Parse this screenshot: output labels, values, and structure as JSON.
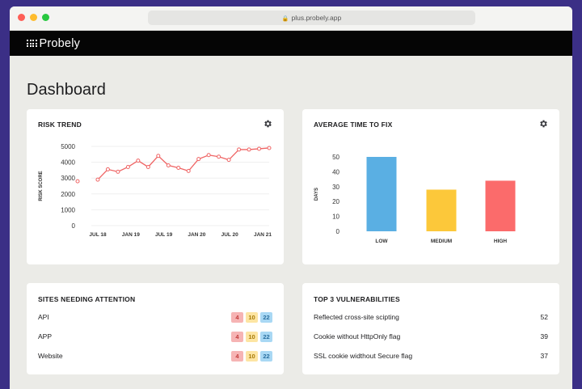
{
  "browser": {
    "url": "plus.probely.app"
  },
  "app": {
    "brand": "Probely"
  },
  "page": {
    "title": "Dashboard"
  },
  "risk_trend": {
    "title": "RISK TREND",
    "chart_data": {
      "type": "line",
      "title": "RISK TREND",
      "ylabel": "RISK SCORE",
      "xlabel": "",
      "ylim": [
        0,
        5000
      ],
      "yticks": [
        0,
        1000,
        2000,
        3000,
        4000,
        5000
      ],
      "xtick_labels": [
        "JUL 18",
        "JAN 19",
        "JUL 19",
        "JAN 20",
        "JUL 20",
        "JAN 21"
      ],
      "grid": true,
      "color": "#ef6464",
      "series": [
        {
          "values": [
            2800,
            null,
            2900,
            3550,
            3400,
            3700,
            4100,
            3700,
            4400,
            3800,
            3650,
            3450,
            4200,
            4450,
            4350,
            4150,
            4800,
            4800,
            4850,
            4900
          ]
        }
      ]
    }
  },
  "avg_time_fix": {
    "title": "AVERAGE TIME TO FIX",
    "chart_data": {
      "type": "bar",
      "title": "AVERAGE TIME TO FIX",
      "ylabel": "DAYS",
      "xlabel": "",
      "categories": [
        "LOW",
        "MEDIUM",
        "HIGH"
      ],
      "values": [
        50,
        28,
        34
      ],
      "ylim": [
        0,
        50
      ],
      "yticks": [
        0,
        10,
        20,
        30,
        40,
        50
      ],
      "colors": [
        "#5aafe3",
        "#fcc83a",
        "#fb6b6b"
      ]
    }
  },
  "sites": {
    "title": "SITES NEEDING ATTENTION",
    "rows": [
      {
        "name": "API",
        "high": "4",
        "medium": "10",
        "low": "22"
      },
      {
        "name": "APP",
        "high": "4",
        "medium": "10",
        "low": "22"
      },
      {
        "name": "Website",
        "high": "4",
        "medium": "10",
        "low": "22"
      }
    ]
  },
  "top_vulns": {
    "title": "TOP 3 VULNERABILITIES",
    "rows": [
      {
        "name": "Reflected cross-site scipting",
        "count": "52"
      },
      {
        "name": "Cookie without HttpOnly flag",
        "count": "39"
      },
      {
        "name": "SSL cookie widthout Secure flag",
        "count": "37"
      }
    ]
  },
  "icons": {
    "settings": "gear-icon",
    "lock": "lock-icon",
    "logo": "probely-logo-icon"
  }
}
